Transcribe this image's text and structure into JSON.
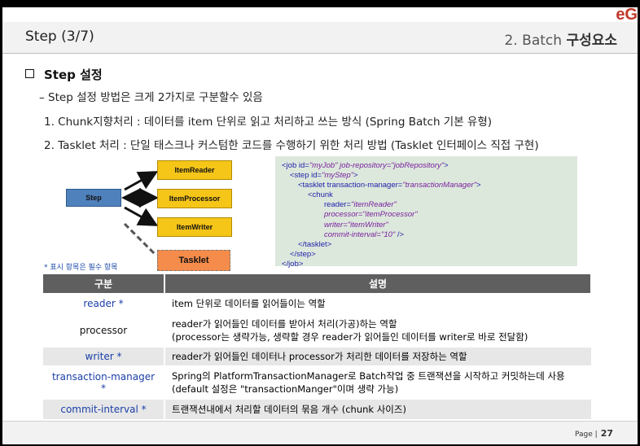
{
  "brand": "eG",
  "header": {
    "left": "Step (3/7)",
    "right_prefix": "2. Batch ",
    "right_bold": "구성요소"
  },
  "section_title": "Step 설정",
  "lines": {
    "intro": "–   Step 설정 방법은 크게 2가지로 구분할수 있음",
    "chunk": "1. Chunk지향처리 : 데이터를 item 단위로 읽고 처리하고 쓰는 방식 (Spring Batch 기본 유형)",
    "tasklet": "2. Tasklet 처리 : 단일 태스크나 커스텀한 코드를 수행하기 위한  처리 방법 (Tasklet 인터페이스 직접 구현)"
  },
  "diagram": {
    "step": "Step",
    "reader": "ItemReader",
    "processor": "ItemProcessor",
    "writer": "ItemWriter",
    "tasklet": "Tasklet"
  },
  "xml": {
    "l1a": "<job id=",
    "l1b": "\"myJob\" job-repository=\"jobRepository\"",
    "l1c": ">",
    "l2a": "<step id=",
    "l2b": "\"myStep\"",
    "l2c": ">",
    "l3a": "<tasklet transaction-manager=",
    "l3b": "\"transactionManager\"",
    "l3c": ">",
    "l4": "<chunk",
    "l5a": "reader=",
    "l5b": "\"itemReader\"",
    "l6a": "processor=",
    "l6b": "\"itemProcessor\"",
    "l7a": "writer=",
    "l7b": "\"itemWriter\"",
    "l8a": "commit-interval=",
    "l8b": "\"10\"",
    "l8c": " />",
    "l9": "</tasklet>",
    "l10": "</step>",
    "l11": "</job>"
  },
  "note": "* 표시 항목은 필수 항목",
  "table": {
    "headers": [
      "구분",
      "설명"
    ],
    "rows": [
      {
        "key": "reader *",
        "desc1": "item 단위로 데이터를 읽어들이는 역할",
        "desc2": ""
      },
      {
        "key": "processor",
        "desc1": "reader가 읽어들인 데이터를 받아서 처리(가공)하는 역할",
        "desc2": "(processor는 생략가능, 생략할 경우 reader가 읽어들인 데이터를 writer로 바로 전달함)"
      },
      {
        "key": "writer *",
        "desc1": "reader가 읽어들인 데이터나 processor가 처리한 데이터를 저장하는 역할",
        "desc2": ""
      },
      {
        "key": "transaction-manager *",
        "desc1": "Spring의 PlatformTransactionManager로 Batch작업 중 트랜잭션을 시작하고 커밋하는데 사용",
        "desc2": "(default 설정은 \"transactionManger\"이며 생략 가능)"
      },
      {
        "key": "commit-interval *",
        "desc1": "트랜잭션내에서 처리할 데이터의 묶음 개수 (chunk 사이즈)",
        "desc2": ""
      }
    ]
  },
  "footer": {
    "label": "Page  |",
    "number": "27"
  },
  "colors": {
    "accent_blue": "#1a3fa8",
    "header_bar": "#5f5f5f",
    "step_box": "#4f81bd",
    "item_box": "#f5c518",
    "tasklet_box": "#f58c4b"
  }
}
